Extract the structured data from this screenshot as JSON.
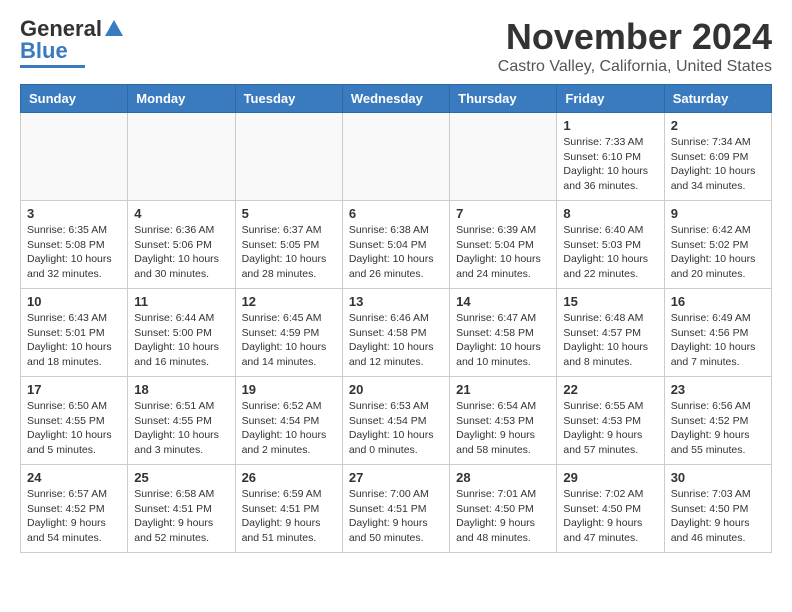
{
  "header": {
    "logo_line1": "General",
    "logo_line2": "Blue",
    "title": "November 2024",
    "subtitle": "Castro Valley, California, United States"
  },
  "days_of_week": [
    "Sunday",
    "Monday",
    "Tuesday",
    "Wednesday",
    "Thursday",
    "Friday",
    "Saturday"
  ],
  "weeks": [
    [
      {
        "day": "",
        "info": ""
      },
      {
        "day": "",
        "info": ""
      },
      {
        "day": "",
        "info": ""
      },
      {
        "day": "",
        "info": ""
      },
      {
        "day": "",
        "info": ""
      },
      {
        "day": "1",
        "info": "Sunrise: 7:33 AM\nSunset: 6:10 PM\nDaylight: 10 hours and 36 minutes."
      },
      {
        "day": "2",
        "info": "Sunrise: 7:34 AM\nSunset: 6:09 PM\nDaylight: 10 hours and 34 minutes."
      }
    ],
    [
      {
        "day": "3",
        "info": "Sunrise: 6:35 AM\nSunset: 5:08 PM\nDaylight: 10 hours and 32 minutes."
      },
      {
        "day": "4",
        "info": "Sunrise: 6:36 AM\nSunset: 5:06 PM\nDaylight: 10 hours and 30 minutes."
      },
      {
        "day": "5",
        "info": "Sunrise: 6:37 AM\nSunset: 5:05 PM\nDaylight: 10 hours and 28 minutes."
      },
      {
        "day": "6",
        "info": "Sunrise: 6:38 AM\nSunset: 5:04 PM\nDaylight: 10 hours and 26 minutes."
      },
      {
        "day": "7",
        "info": "Sunrise: 6:39 AM\nSunset: 5:04 PM\nDaylight: 10 hours and 24 minutes."
      },
      {
        "day": "8",
        "info": "Sunrise: 6:40 AM\nSunset: 5:03 PM\nDaylight: 10 hours and 22 minutes."
      },
      {
        "day": "9",
        "info": "Sunrise: 6:42 AM\nSunset: 5:02 PM\nDaylight: 10 hours and 20 minutes."
      }
    ],
    [
      {
        "day": "10",
        "info": "Sunrise: 6:43 AM\nSunset: 5:01 PM\nDaylight: 10 hours and 18 minutes."
      },
      {
        "day": "11",
        "info": "Sunrise: 6:44 AM\nSunset: 5:00 PM\nDaylight: 10 hours and 16 minutes."
      },
      {
        "day": "12",
        "info": "Sunrise: 6:45 AM\nSunset: 4:59 PM\nDaylight: 10 hours and 14 minutes."
      },
      {
        "day": "13",
        "info": "Sunrise: 6:46 AM\nSunset: 4:58 PM\nDaylight: 10 hours and 12 minutes."
      },
      {
        "day": "14",
        "info": "Sunrise: 6:47 AM\nSunset: 4:58 PM\nDaylight: 10 hours and 10 minutes."
      },
      {
        "day": "15",
        "info": "Sunrise: 6:48 AM\nSunset: 4:57 PM\nDaylight: 10 hours and 8 minutes."
      },
      {
        "day": "16",
        "info": "Sunrise: 6:49 AM\nSunset: 4:56 PM\nDaylight: 10 hours and 7 minutes."
      }
    ],
    [
      {
        "day": "17",
        "info": "Sunrise: 6:50 AM\nSunset: 4:55 PM\nDaylight: 10 hours and 5 minutes."
      },
      {
        "day": "18",
        "info": "Sunrise: 6:51 AM\nSunset: 4:55 PM\nDaylight: 10 hours and 3 minutes."
      },
      {
        "day": "19",
        "info": "Sunrise: 6:52 AM\nSunset: 4:54 PM\nDaylight: 10 hours and 2 minutes."
      },
      {
        "day": "20",
        "info": "Sunrise: 6:53 AM\nSunset: 4:54 PM\nDaylight: 10 hours and 0 minutes."
      },
      {
        "day": "21",
        "info": "Sunrise: 6:54 AM\nSunset: 4:53 PM\nDaylight: 9 hours and 58 minutes."
      },
      {
        "day": "22",
        "info": "Sunrise: 6:55 AM\nSunset: 4:53 PM\nDaylight: 9 hours and 57 minutes."
      },
      {
        "day": "23",
        "info": "Sunrise: 6:56 AM\nSunset: 4:52 PM\nDaylight: 9 hours and 55 minutes."
      }
    ],
    [
      {
        "day": "24",
        "info": "Sunrise: 6:57 AM\nSunset: 4:52 PM\nDaylight: 9 hours and 54 minutes."
      },
      {
        "day": "25",
        "info": "Sunrise: 6:58 AM\nSunset: 4:51 PM\nDaylight: 9 hours and 52 minutes."
      },
      {
        "day": "26",
        "info": "Sunrise: 6:59 AM\nSunset: 4:51 PM\nDaylight: 9 hours and 51 minutes."
      },
      {
        "day": "27",
        "info": "Sunrise: 7:00 AM\nSunset: 4:51 PM\nDaylight: 9 hours and 50 minutes."
      },
      {
        "day": "28",
        "info": "Sunrise: 7:01 AM\nSunset: 4:50 PM\nDaylight: 9 hours and 48 minutes."
      },
      {
        "day": "29",
        "info": "Sunrise: 7:02 AM\nSunset: 4:50 PM\nDaylight: 9 hours and 47 minutes."
      },
      {
        "day": "30",
        "info": "Sunrise: 7:03 AM\nSunset: 4:50 PM\nDaylight: 9 hours and 46 minutes."
      }
    ]
  ]
}
